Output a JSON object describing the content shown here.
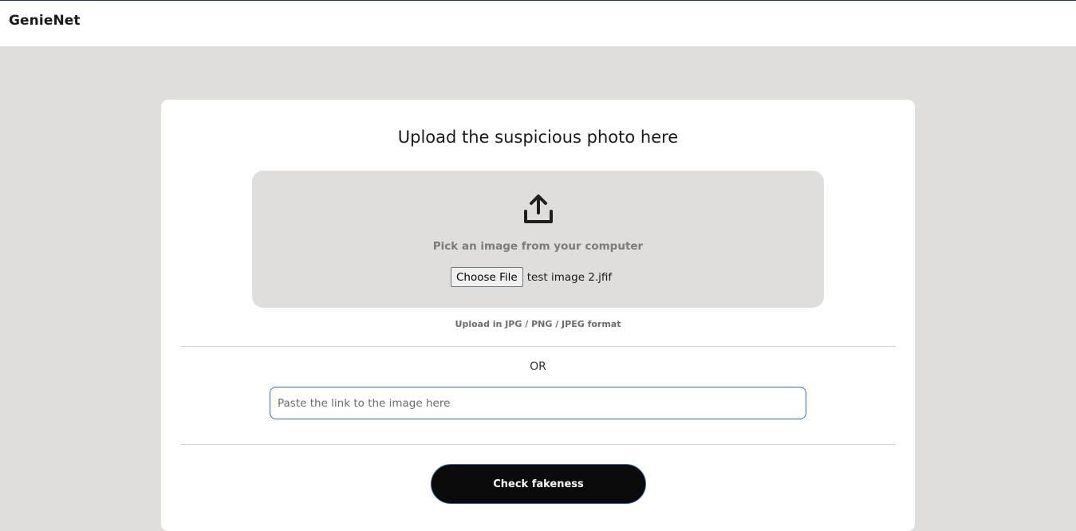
{
  "header": {
    "brand": "GenieNet"
  },
  "upload": {
    "title": "Upload the suspicious photo here",
    "icon": "upload-icon",
    "pick_text": "Pick an image from your computer",
    "choose_label": "Choose File",
    "file_name": "test image 2.jfif",
    "format_hint": "Upload in JPG / PNG / JPEG format"
  },
  "separator": {
    "or_text": "OR"
  },
  "link": {
    "value": "",
    "placeholder": "Paste the link to the image here"
  },
  "actions": {
    "check_label": "Check fakeness"
  },
  "colors": {
    "page_bg": "#dfdedd",
    "card_bg": "#ffffff",
    "button_bg": "#0a0a0a",
    "input_border": "#2f6fc0"
  }
}
